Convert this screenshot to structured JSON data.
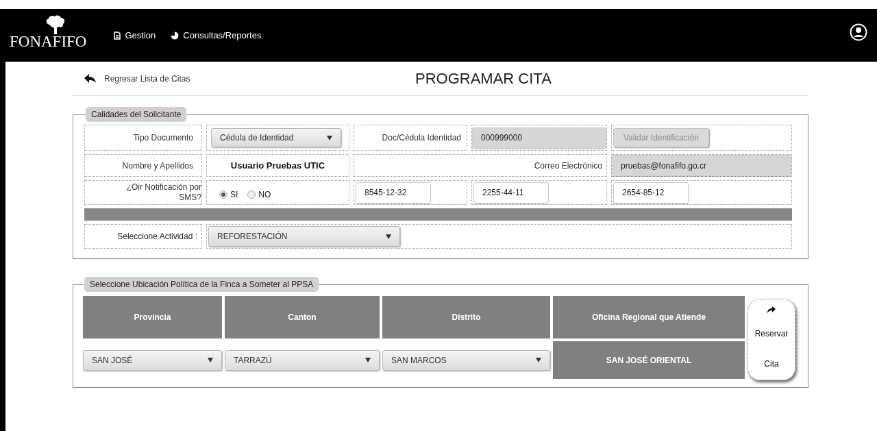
{
  "header": {
    "logo": "FONAFIFO",
    "nav": [
      {
        "label": "Gestion",
        "kind": "document"
      },
      {
        "label": "Consultas/Reportes",
        "kind": "pie"
      }
    ]
  },
  "back_link": "Regresar Lista de Citas",
  "title": "PROGRAMAR CITA",
  "applicant": {
    "legend": "Calidades del Solicitante",
    "document_type": {
      "label": "Tipo Documento",
      "value": "Cédula de Identidad"
    },
    "document_number": {
      "label": "Doc/Cédula Identidad",
      "value": "000999000",
      "disabled": true
    },
    "validate_button": {
      "label": "Validar Identificación",
      "disabled": true
    },
    "name": {
      "label": "Nombre y Apellidos",
      "value": "Usuario Pruebas UTIC"
    },
    "email": {
      "label": "Correo Electrónico",
      "value": "pruebas@fonafifo.go.cr",
      "disabled": true
    },
    "sms": {
      "label": "¿Oir Notificación por SMS?",
      "options": [
        {
          "label": "SI",
          "selected": true
        },
        {
          "label": "NO",
          "selected": false
        }
      ]
    },
    "phones": [
      "8545-12-32",
      "2255-44-11",
      "2654-85-12"
    ],
    "activity": {
      "label": "Seleccione Actividad :",
      "value": "REFORESTACIÓN"
    }
  },
  "location": {
    "legend": "Seleccione Ubicación Política de la Finca a Someter al PPSA",
    "columns": [
      "Provincia",
      "Canton",
      "Distrito",
      "Oficina Regional que Atiende"
    ],
    "selects": [
      "SAN JOSÉ",
      "TARRAZÚ",
      "SAN MARCOS"
    ],
    "office": "SAN JOSÉ ORIENTAL",
    "reserve_button": "Reservar Cita"
  }
}
